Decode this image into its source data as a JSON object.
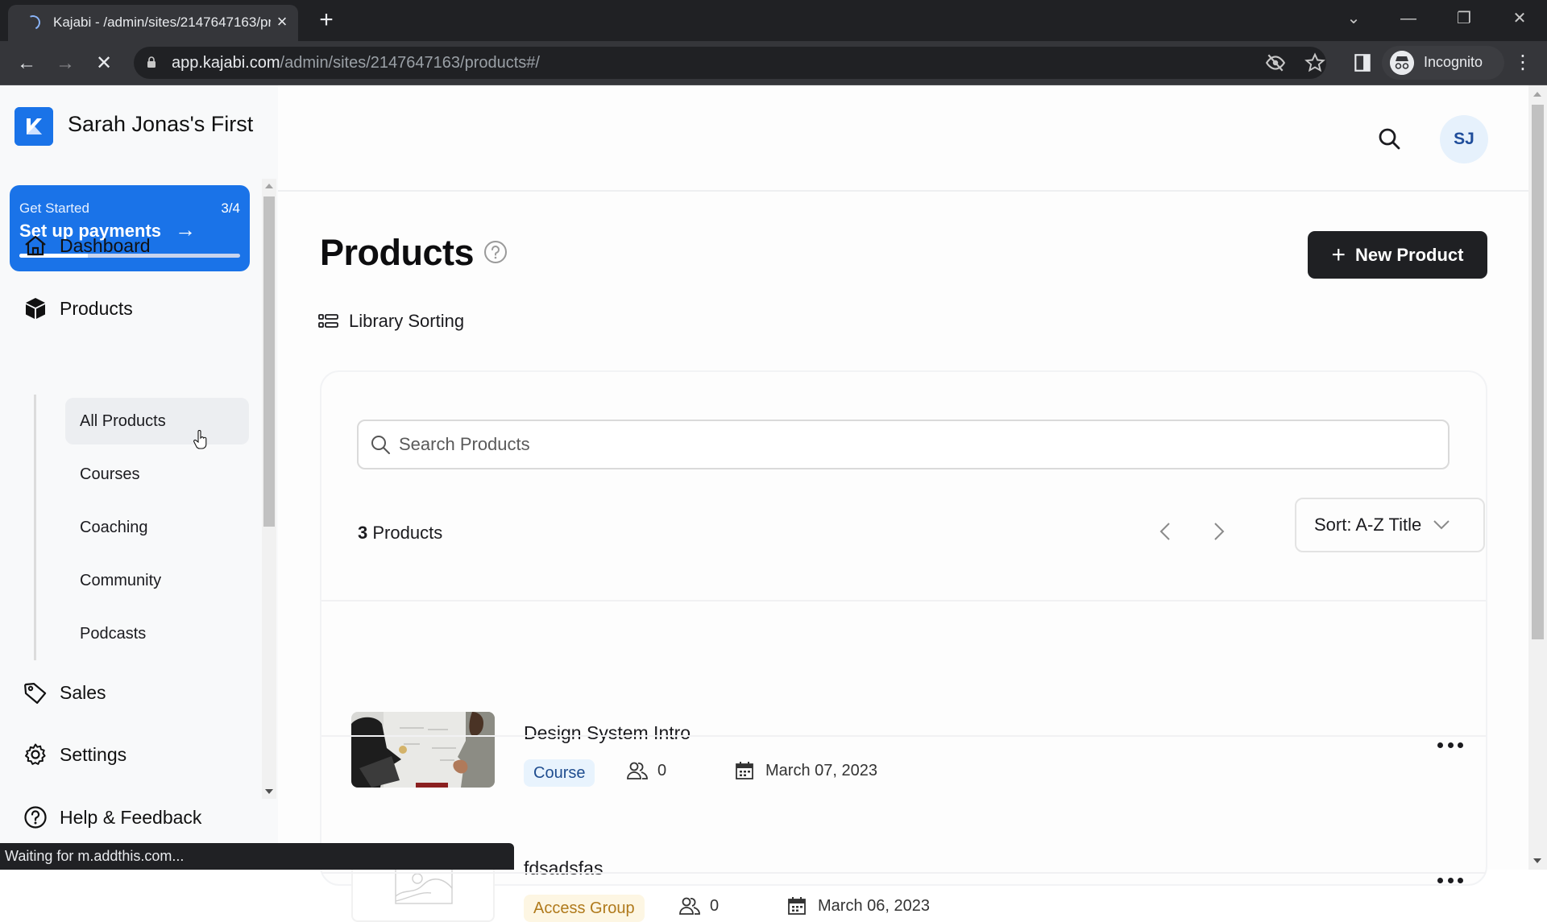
{
  "browser": {
    "tab_title": "Kajabi - /admin/sites/2147647163/products#/",
    "tab_close": "×",
    "new_tab": "+",
    "url_host": "app.kajabi.com",
    "url_path": "/admin/sites/2147647163/products#/",
    "profile_label": "Incognito",
    "window_controls": {
      "tab_search": "⌄",
      "minimize": "—",
      "restore": "❐",
      "close": "✕"
    },
    "nav": {
      "back": "←",
      "forward": "→",
      "stop": "✕"
    },
    "status_text": "Waiting for m.addthis.com..."
  },
  "sidebar": {
    "site_name": "Sarah Jonas's First",
    "get_started": {
      "label": "Get Started",
      "step_count": "3/4",
      "action": "Set up payments",
      "arrow": "→",
      "progress": 0.31
    },
    "items": [
      {
        "label": "Dashboard",
        "icon": "home-icon"
      },
      {
        "label": "Products",
        "icon": "box-icon"
      },
      {
        "label": "Sales",
        "icon": "tag-icon"
      },
      {
        "label": "Settings",
        "icon": "gear-icon"
      },
      {
        "label": "Help & Feedback",
        "icon": "help-circle-icon"
      }
    ],
    "product_subitems": [
      {
        "label": "All Products",
        "active": true
      },
      {
        "label": "Courses",
        "active": false
      },
      {
        "label": "Coaching",
        "active": false
      },
      {
        "label": "Community",
        "active": false
      },
      {
        "label": "Podcasts",
        "active": false
      }
    ]
  },
  "header": {
    "avatar_initials": "SJ"
  },
  "page": {
    "title": "Products",
    "new_product_label": "New Product",
    "library_sorting_label": "Library Sorting",
    "search_placeholder": "Search Products",
    "search_value": "",
    "count_number": "3",
    "count_label": "Products",
    "sort_label": "Sort: A-Z Title"
  },
  "products": [
    {
      "name": "Design System Intro",
      "type": "Course",
      "members": "0",
      "date": "March 07, 2023",
      "thumbnail": "photo"
    },
    {
      "name": "fdsadsfas",
      "type": "Access Group",
      "members": "0",
      "date": "March 06, 2023",
      "thumbnail": "placeholder"
    }
  ],
  "colors": {
    "brand_blue": "#1a73e8",
    "primary_button": "#1f2023",
    "course_badge_bg": "#e8f3fd",
    "course_badge_text": "#1f4d8f",
    "access_badge_bg": "#fdf6e3",
    "access_badge_text": "#b07a1c"
  }
}
